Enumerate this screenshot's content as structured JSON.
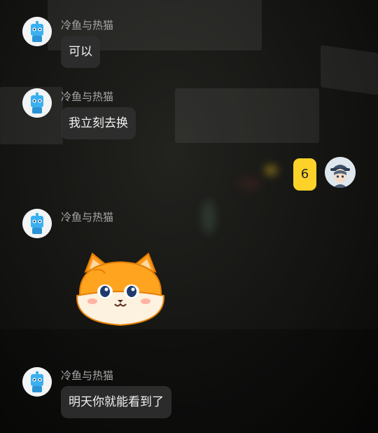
{
  "messages": [
    {
      "sender": "冷鱼与热猫",
      "text": "可以"
    },
    {
      "sender": "冷鱼与热猫",
      "text": "我立刻去换"
    },
    {
      "sender": "冷鱼与热猫",
      "sticker": "orange-cat-face-sticker"
    },
    {
      "sender": "冷鱼与热猫",
      "text": "明天你就能看到了"
    }
  ],
  "my_reply": {
    "text": "6"
  },
  "colors": {
    "my_bubble": "#ffd22a",
    "other_bubble": "#2e2e2e",
    "sender_name": "#a8a8a8"
  },
  "icons": {
    "contact_avatar": "blue-robot-avatar-icon",
    "my_avatar": "anime-boy-avatar-icon"
  }
}
